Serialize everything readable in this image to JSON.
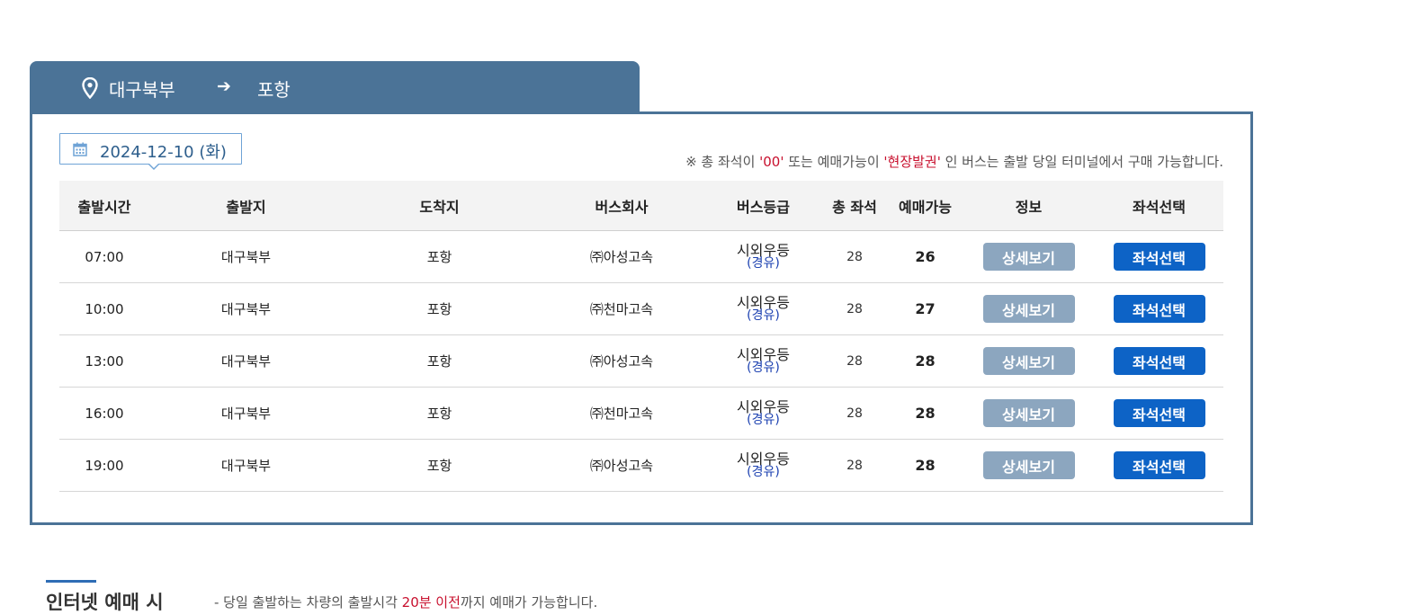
{
  "route": {
    "origin": "대구북부",
    "arrow": "➔",
    "destination": "포항"
  },
  "date": {
    "text": "2024-12-10 (화)"
  },
  "notice": {
    "prefix": "※ 총 좌석이 ",
    "zero": "'00'",
    "middle": " 또는 예매가능이 ",
    "onsite": "'현장발권'",
    "suffix": " 인 버스는 출발 당일 터미널에서 구매 가능합니다."
  },
  "table": {
    "headers": [
      "출발시간",
      "출발지",
      "도착지",
      "버스회사",
      "버스등급",
      "총 좌석",
      "예매가능",
      "정보",
      "좌석선택"
    ],
    "rows": [
      {
        "time": "07:00",
        "origin": "대구북부",
        "dest": "포항",
        "company": "㈜아성고속",
        "grade": "시외우등",
        "grade_sub": "(경유)",
        "total": "28",
        "available": "26",
        "detail": "상세보기",
        "seat": "좌석선택"
      },
      {
        "time": "10:00",
        "origin": "대구북부",
        "dest": "포항",
        "company": "㈜천마고속",
        "grade": "시외우등",
        "grade_sub": "(경유)",
        "total": "28",
        "available": "27",
        "detail": "상세보기",
        "seat": "좌석선택"
      },
      {
        "time": "13:00",
        "origin": "대구북부",
        "dest": "포항",
        "company": "㈜아성고속",
        "grade": "시외우등",
        "grade_sub": "(경유)",
        "total": "28",
        "available": "28",
        "detail": "상세보기",
        "seat": "좌석선택"
      },
      {
        "time": "16:00",
        "origin": "대구북부",
        "dest": "포항",
        "company": "㈜천마고속",
        "grade": "시외우등",
        "grade_sub": "(경유)",
        "total": "28",
        "available": "28",
        "detail": "상세보기",
        "seat": "좌석선택"
      },
      {
        "time": "19:00",
        "origin": "대구북부",
        "dest": "포항",
        "company": "㈜아성고속",
        "grade": "시외우등",
        "grade_sub": "(경유)",
        "total": "28",
        "available": "28",
        "detail": "상세보기",
        "seat": "좌석선택"
      }
    ]
  },
  "info": {
    "title": "인터넷 예매 시",
    "prefix": "- 당일 출발하는 차량의 출발시각 ",
    "highlight": "20분 이전",
    "suffix": "까지 예매가 가능합니다."
  },
  "colors": {
    "header_bg": "#4b7397",
    "seat_button": "#0d63c6",
    "detail_button": "#8ca6bf",
    "highlight_red": "#c8102e"
  },
  "icons": [
    "map-pin-icon",
    "arrow-right-icon",
    "calendar-icon"
  ]
}
